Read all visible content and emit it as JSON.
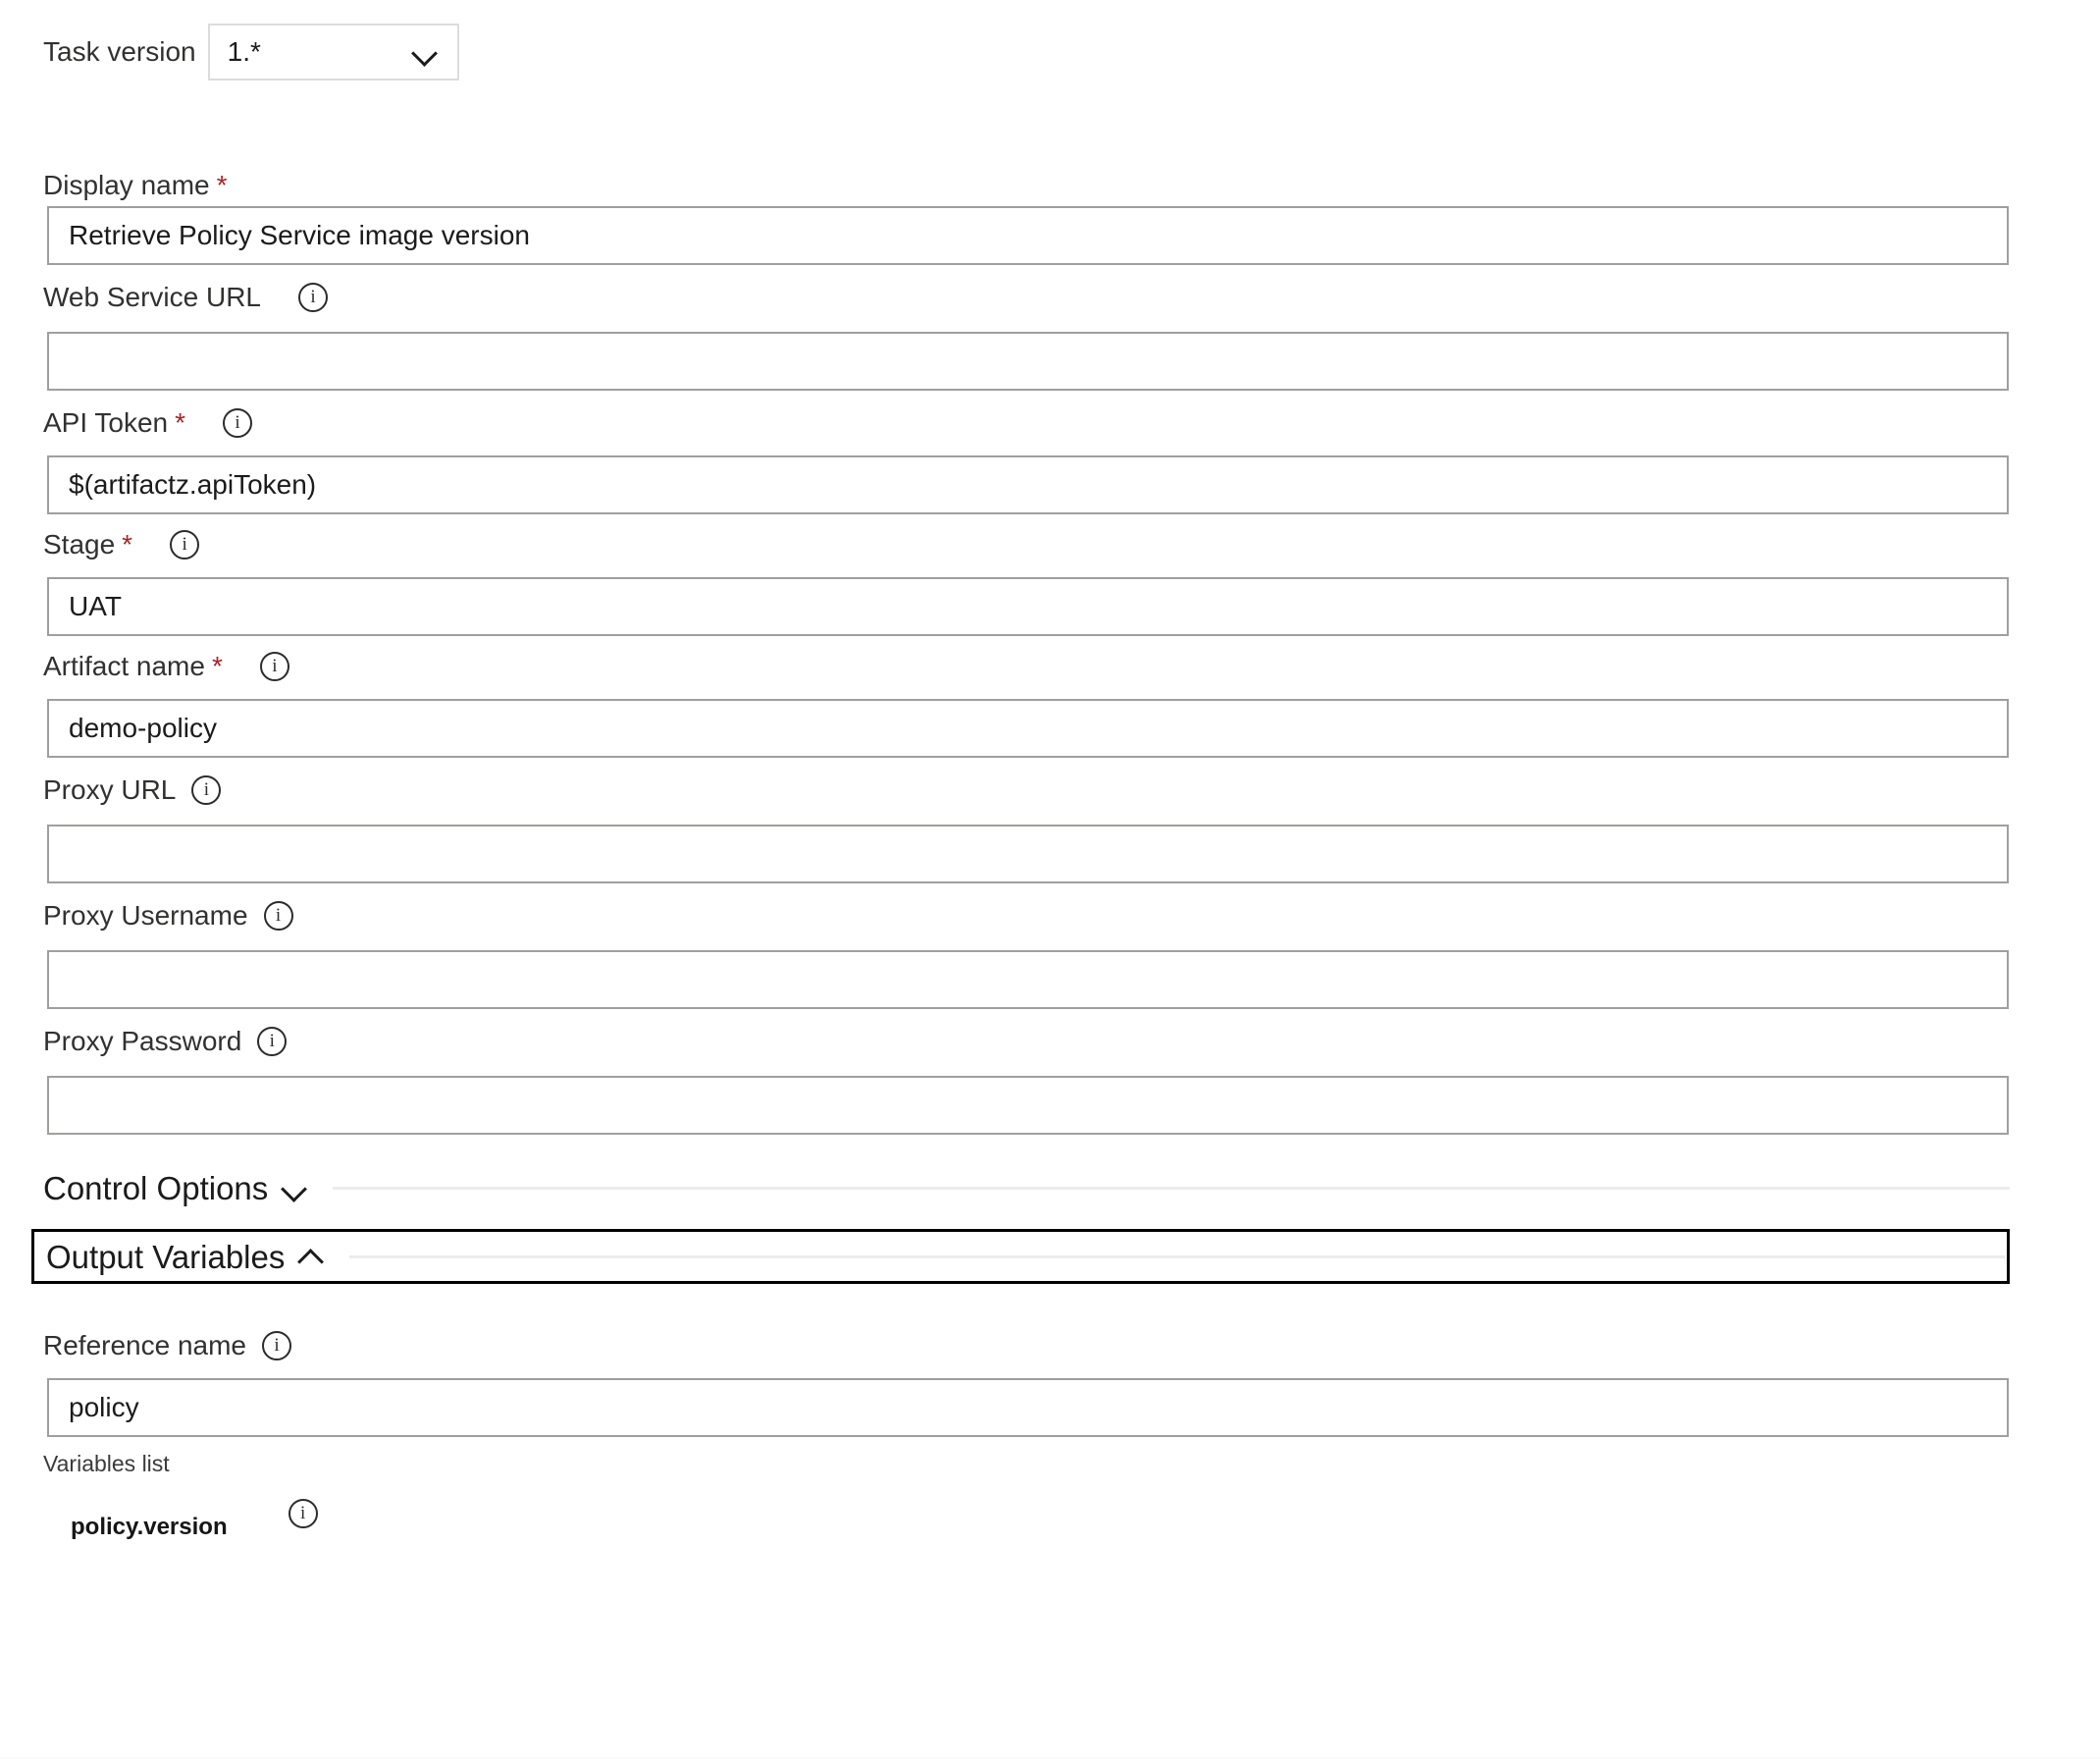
{
  "task_version": {
    "label": "Task version",
    "value": "1.*",
    "chevron_icon": "chevron-down-icon"
  },
  "fields": [
    {
      "id": "display-name",
      "label": "Display name",
      "required": true,
      "has_info": false,
      "value": "Retrieve Policy Service image version",
      "placeholder": ""
    },
    {
      "id": "web-service-url",
      "label": "Web Service URL",
      "required": false,
      "has_info": true,
      "value": "",
      "placeholder": ""
    },
    {
      "id": "api-token",
      "label": "API Token",
      "required": true,
      "has_info": true,
      "value": "$(artifactz.apiToken)",
      "placeholder": ""
    },
    {
      "id": "stage",
      "label": "Stage",
      "required": true,
      "has_info": true,
      "value": "UAT",
      "placeholder": ""
    },
    {
      "id": "artifact-name",
      "label": "Artifact name",
      "required": true,
      "has_info": true,
      "value": "demo-policy",
      "placeholder": ""
    },
    {
      "id": "proxy-url",
      "label": "Proxy URL",
      "required": false,
      "has_info": true,
      "value": "",
      "placeholder": ""
    },
    {
      "id": "proxy-username",
      "label": "Proxy Username",
      "required": false,
      "has_info": true,
      "value": "",
      "placeholder": ""
    },
    {
      "id": "proxy-password",
      "label": "Proxy Password",
      "required": false,
      "has_info": true,
      "value": "",
      "placeholder": ""
    }
  ],
  "sections": {
    "control_options": {
      "title": "Control Options",
      "expanded": false,
      "chevron_icon": "chevron-down-icon",
      "focused": false
    },
    "output_variables": {
      "title": "Output Variables",
      "expanded": true,
      "chevron_icon": "chevron-up-icon",
      "focused": true
    }
  },
  "output_variables": {
    "reference_name": {
      "label": "Reference name",
      "required": false,
      "has_info": true,
      "value": "policy",
      "placeholder": ""
    },
    "variables_list_label": "Variables list",
    "variables": [
      {
        "name": "policy.version",
        "has_info": true
      }
    ]
  },
  "icons": {
    "info": "info-icon",
    "info_glyph": "i"
  },
  "colors": {
    "required_star": "#a4262c",
    "label_text": "#323130",
    "input_border": "#a19f9d",
    "dropdown_border": "#dcdcdc",
    "section_rule": "#ececec",
    "focus_outline": "#000000",
    "background": "#ffffff"
  }
}
